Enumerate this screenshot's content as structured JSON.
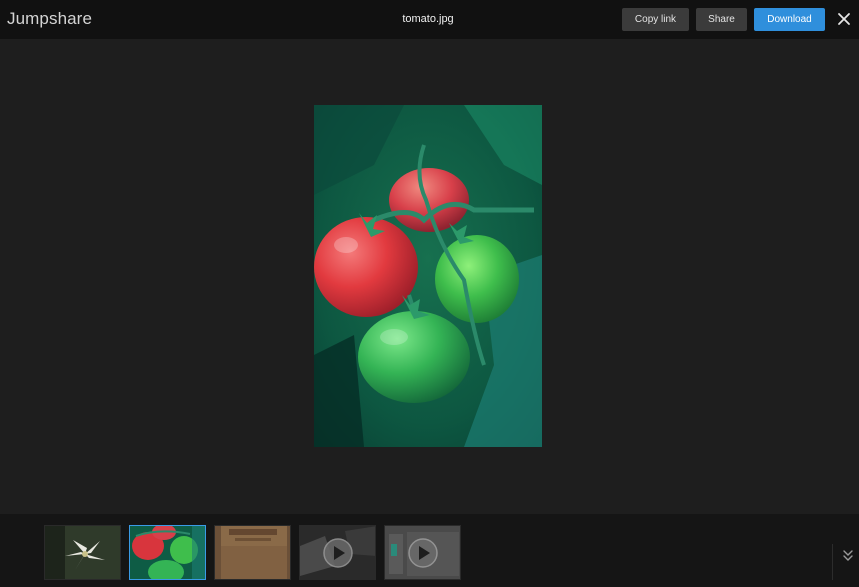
{
  "header": {
    "logo": "Jumpshare",
    "filename": "tomato.jpg",
    "copy_link_label": "Copy link",
    "share_label": "Share",
    "download_label": "Download",
    "close_icon": "close-icon"
  },
  "colors": {
    "header_bg": "#111111",
    "viewer_bg": "#1e1e1e",
    "accent": "#2f8fdc",
    "button_bg": "#3b3b3b"
  },
  "main_image": {
    "subject": "tomato-photo"
  },
  "filmstrip": {
    "thumbnails": [
      {
        "kind": "image",
        "icon": "flower-thumbnail"
      },
      {
        "kind": "image",
        "icon": "tomato-thumbnail",
        "selected": true
      },
      {
        "kind": "image",
        "icon": "document-thumbnail"
      },
      {
        "kind": "video",
        "icon": "play-icon"
      },
      {
        "kind": "video",
        "icon": "play-icon"
      }
    ],
    "collapse_icon": "double-chevron-down-icon"
  }
}
